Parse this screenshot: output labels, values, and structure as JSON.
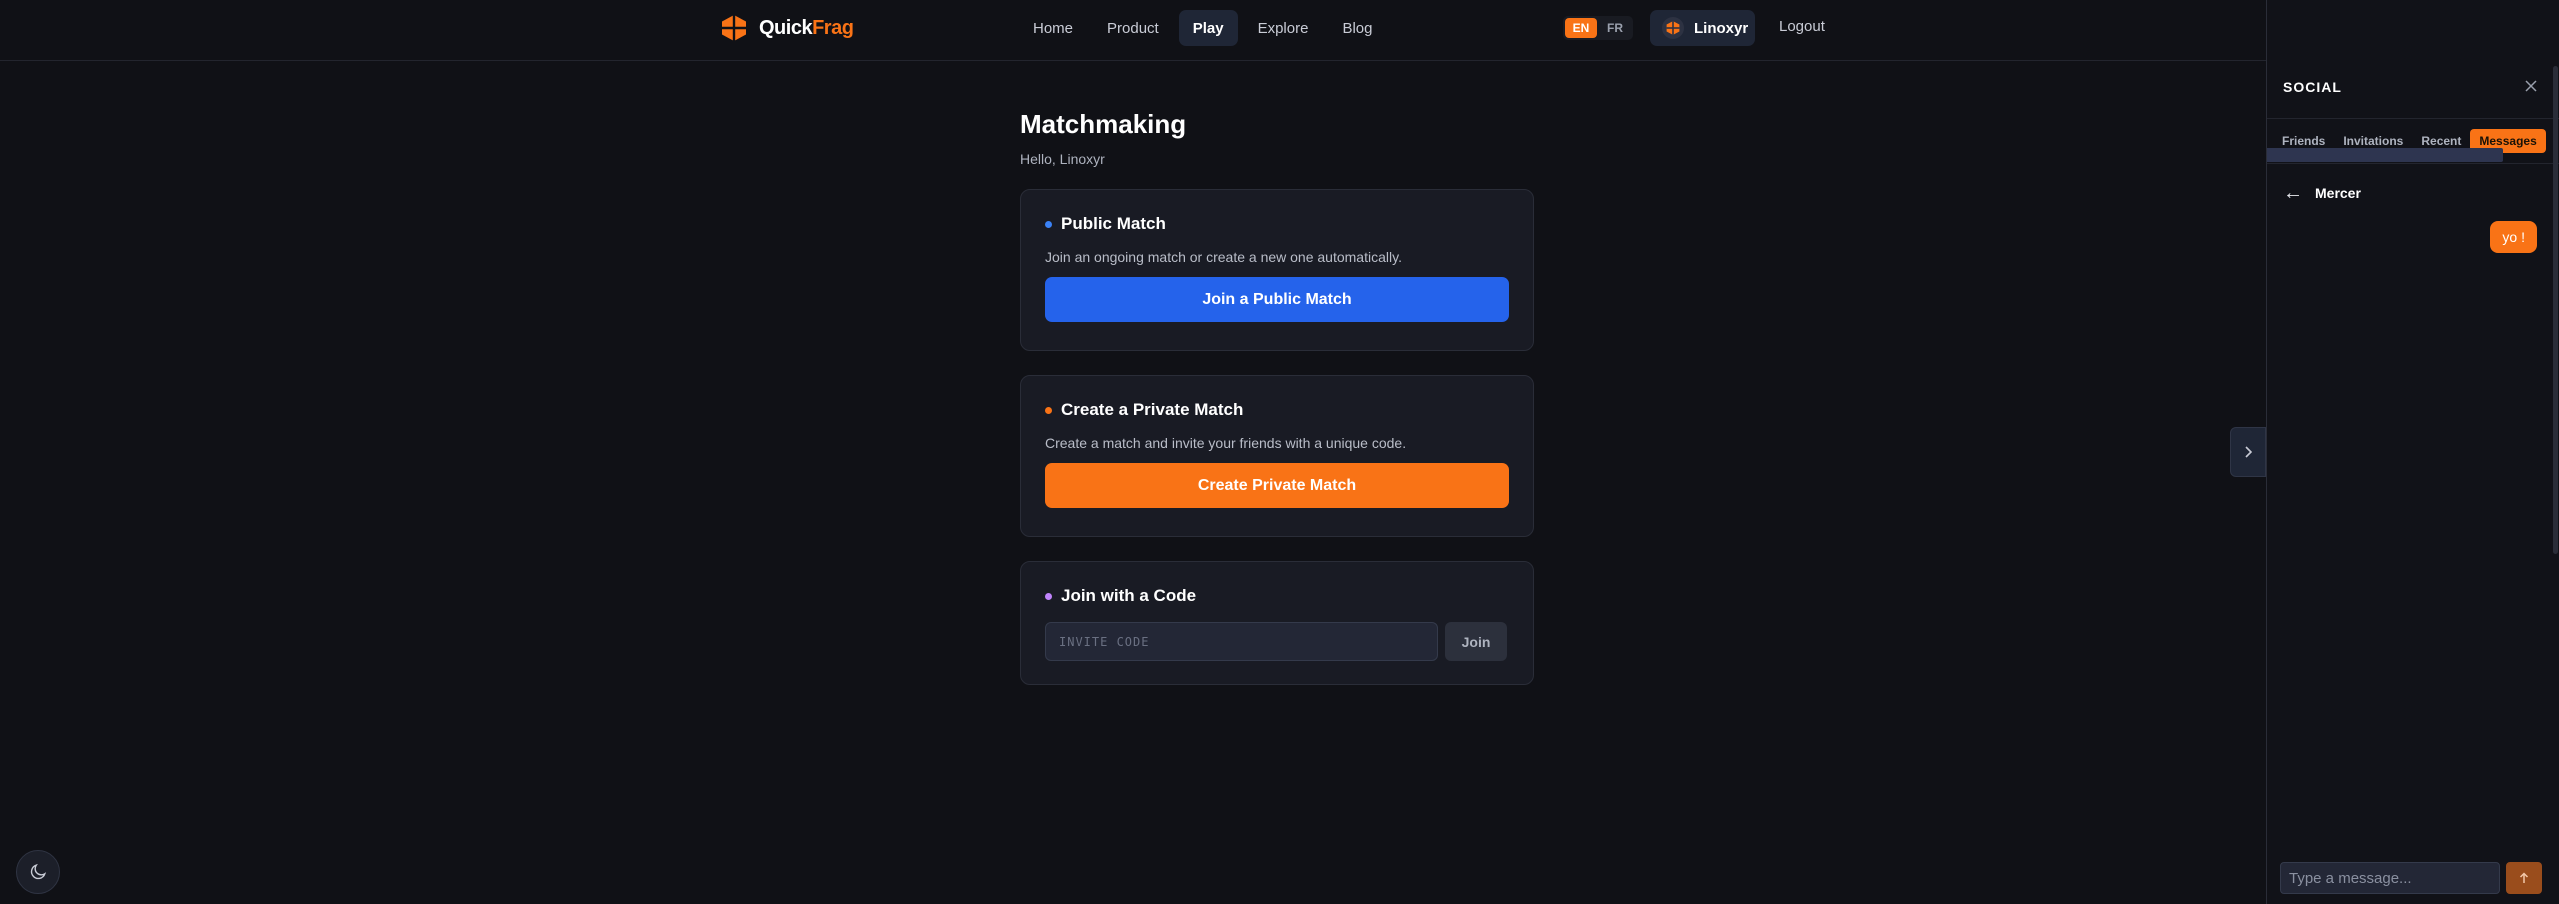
{
  "header": {
    "logo": {
      "part1": "Quick",
      "part2": "Frag",
      "icon": "cube-logo-icon"
    },
    "nav": [
      {
        "label": "Home",
        "active": false
      },
      {
        "label": "Product",
        "active": false
      },
      {
        "label": "Play",
        "active": true
      },
      {
        "label": "Explore",
        "active": false
      },
      {
        "label": "Blog",
        "active": false
      }
    ],
    "languages": [
      {
        "label": "EN",
        "active": true
      },
      {
        "label": "FR",
        "active": false
      }
    ],
    "user": {
      "name": "Linoxyr",
      "icon": "avatar-icon"
    },
    "logout_label": "Logout"
  },
  "main": {
    "title": "Matchmaking",
    "greeting": "Hello, Linoxyr",
    "cards": {
      "public": {
        "title": "Public Match",
        "description": "Join an ongoing match or create a new one automatically.",
        "button": "Join a Public Match",
        "dot_color": "#3b82f6"
      },
      "private": {
        "title": "Create a Private Match",
        "description": "Create a match and invite your friends with a unique code.",
        "button": "Create Private Match",
        "dot_color": "#f97316"
      },
      "code": {
        "title": "Join with a Code",
        "placeholder": "INVITE CODE",
        "value": "",
        "button": "Join",
        "dot_color": "#c084fc"
      }
    }
  },
  "social": {
    "title": "SOCIAL",
    "tabs": [
      {
        "label": "Friends",
        "active": false
      },
      {
        "label": "Invitations",
        "active": false
      },
      {
        "label": "Recent",
        "active": false
      },
      {
        "label": "Messages",
        "active": true
      }
    ],
    "conversation": {
      "name": "Mercer",
      "messages": [
        {
          "text": "yo !",
          "from_me": true
        }
      ]
    },
    "composer": {
      "placeholder": "Type a message...",
      "value": ""
    }
  },
  "colors": {
    "accent": "#f97316",
    "primary": "#2563eb",
    "background": "#101116",
    "card": "#191b24"
  },
  "icons": {
    "close": "close-icon",
    "back": "arrow-left-icon",
    "toggle": "chevron-right-icon",
    "theme": "moon-icon",
    "send": "arrow-up-icon"
  }
}
